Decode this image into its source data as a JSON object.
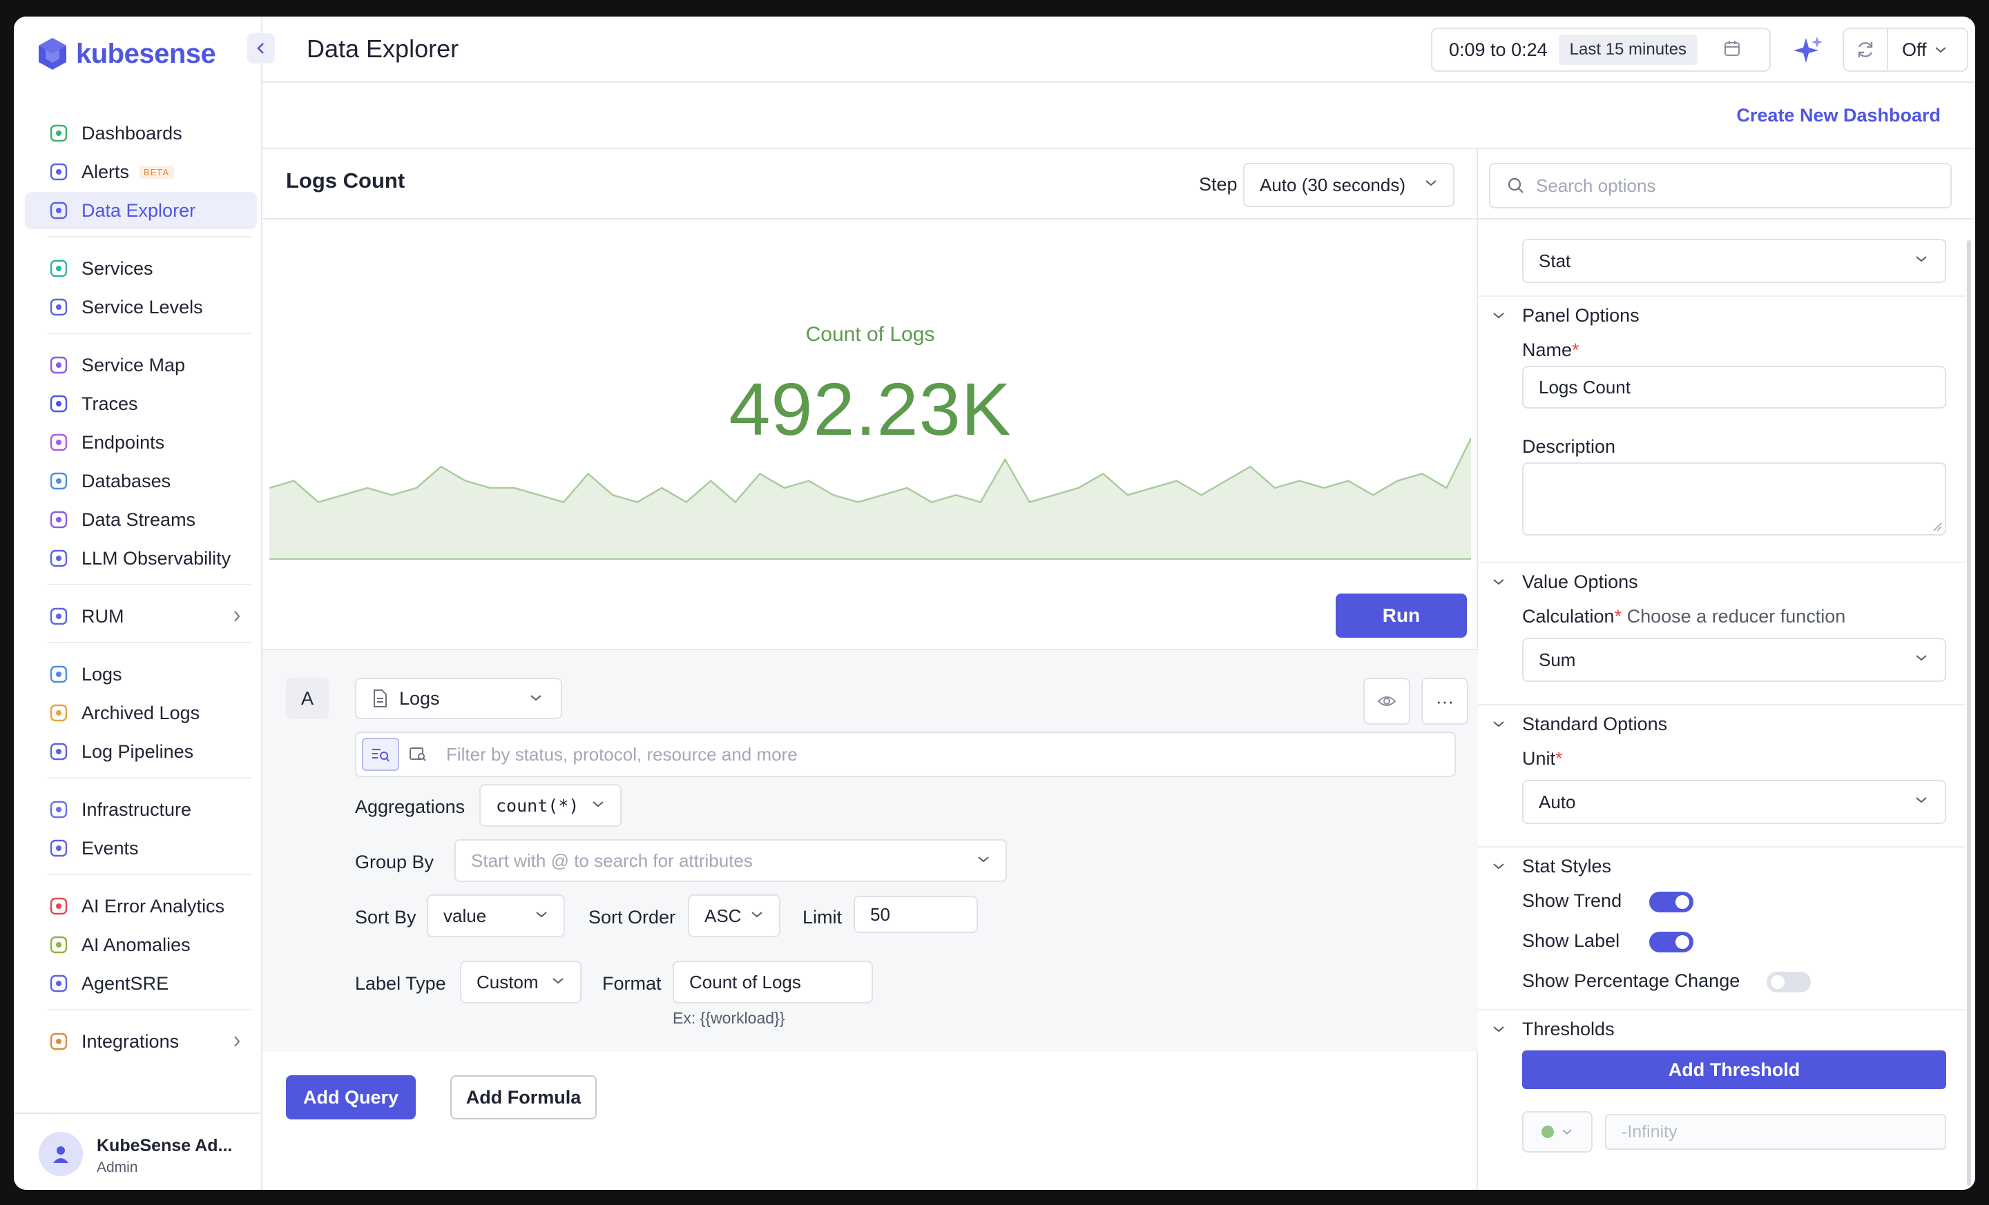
{
  "brand": {
    "name": "kubesense",
    "color": "#4f56e3"
  },
  "sidebar": {
    "items": [
      {
        "label": "Dashboards",
        "icon": "dashboard-icon"
      },
      {
        "label": "Alerts",
        "icon": "alert-icon",
        "badge": "BETA"
      },
      {
        "label": "Data Explorer",
        "icon": "data-explorer-icon",
        "active": true
      },
      {
        "label": "Services",
        "icon": "services-icon"
      },
      {
        "label": "Service Levels",
        "icon": "service-levels-icon"
      },
      {
        "label": "Service Map",
        "icon": "service-map-icon"
      },
      {
        "label": "Traces",
        "icon": "traces-icon"
      },
      {
        "label": "Endpoints",
        "icon": "endpoints-icon"
      },
      {
        "label": "Databases",
        "icon": "database-icon"
      },
      {
        "label": "Data Streams",
        "icon": "data-streams-icon"
      },
      {
        "label": "LLM Observability",
        "icon": "sparkle-icon"
      },
      {
        "label": "RUM",
        "icon": "rum-icon",
        "expandable": true
      },
      {
        "label": "Logs",
        "icon": "logs-icon"
      },
      {
        "label": "Archived Logs",
        "icon": "archived-logs-icon"
      },
      {
        "label": "Log Pipelines",
        "icon": "log-pipelines-icon"
      },
      {
        "label": "Infrastructure",
        "icon": "infrastructure-icon"
      },
      {
        "label": "Events",
        "icon": "events-icon"
      },
      {
        "label": "AI Error Analytics",
        "icon": "ai-error-icon"
      },
      {
        "label": "AI Anomalies",
        "icon": "ai-anomalies-icon"
      },
      {
        "label": "AgentSRE",
        "icon": "agent-sre-icon"
      },
      {
        "label": "Integrations",
        "icon": "integrations-icon",
        "expandable": true
      }
    ],
    "user": {
      "name": "KubeSense Ad...",
      "role": "Admin"
    }
  },
  "header": {
    "title": "Data Explorer",
    "time_range": "0:09 to 0:24",
    "time_preset": "Last 15 minutes",
    "refresh_value": "Off"
  },
  "actions": {
    "create_dashboard": "Create New Dashboard"
  },
  "panel": {
    "title": "Logs Count",
    "step_label": "Step",
    "step_value": "Auto (30 seconds)",
    "stat_label": "Count of Logs",
    "stat_value": "492.23K",
    "stat_color": "#5c9a4c",
    "run_label": "Run"
  },
  "sparkline": {
    "values": [
      10,
      11,
      8,
      9,
      10,
      9,
      10,
      13,
      11,
      10,
      10,
      9,
      8,
      12,
      9,
      8,
      10,
      8,
      11,
      8,
      12,
      10,
      11,
      9,
      8,
      9,
      10,
      8,
      9,
      8,
      14,
      8,
      9,
      10,
      12,
      9,
      10,
      11,
      9,
      11,
      13,
      10,
      11,
      10,
      11,
      9,
      11,
      12,
      10,
      17
    ],
    "ylim": [
      0,
      40
    ]
  },
  "query": {
    "label": "A",
    "source": "Logs",
    "more_label": "···",
    "filter_placeholder": "Filter by status, protocol, resource and more",
    "aggregations_label": "Aggregations",
    "aggregations_value": "count(*)",
    "group_by_label": "Group By",
    "group_by_placeholder": "Start with @ to search for attributes",
    "sort_by_label": "Sort By",
    "sort_by_value": "value",
    "sort_order_label": "Sort Order",
    "sort_order_value": "ASC",
    "limit_label": "Limit",
    "limit_value": "50",
    "label_type_label": "Label Type",
    "label_type_value": "Custom",
    "format_label": "Format",
    "format_value": "Count of Logs",
    "format_hint": "Ex: {{workload}}"
  },
  "query_actions": {
    "add_query": "Add Query",
    "add_formula": "Add Formula"
  },
  "options": {
    "search_placeholder": "Search options",
    "visualization": "Stat",
    "panel_options": {
      "title": "Panel Options",
      "name_label": "Name",
      "name_value": "Logs Count",
      "description_label": "Description"
    },
    "value_options": {
      "title": "Value Options",
      "calc_label": "Calculation",
      "calc_hint": "Choose a reducer function",
      "calc_value": "Sum"
    },
    "standard_options": {
      "title": "Standard Options",
      "unit_label": "Unit",
      "unit_value": "Auto"
    },
    "stat_styles": {
      "title": "Stat Styles",
      "show_trend": "Show Trend",
      "show_trend_on": true,
      "show_label": "Show Label",
      "show_label_on": true,
      "show_pct": "Show Percentage Change",
      "show_pct_on": false
    },
    "thresholds": {
      "title": "Thresholds",
      "add_label": "Add Threshold",
      "first_value": "-Infinity"
    }
  }
}
